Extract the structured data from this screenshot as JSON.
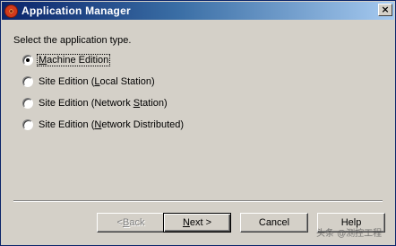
{
  "window": {
    "title": "Application Manager",
    "close_label": "×"
  },
  "prompt": "Select the application type.",
  "options": [
    {
      "pre": "",
      "accel": "M",
      "post": "achine Edition",
      "checked": true
    },
    {
      "pre": "Site Edition (",
      "accel": "L",
      "post": "ocal Station)",
      "checked": false
    },
    {
      "pre": "Site Edition (Network ",
      "accel": "S",
      "post": "tation)",
      "checked": false
    },
    {
      "pre": "Site Edition (",
      "accel": "N",
      "post": "etwork Distributed)",
      "checked": false
    }
  ],
  "buttons": {
    "back": {
      "prefix": "< ",
      "accel": "B",
      "rest": "ack"
    },
    "next": {
      "accel": "N",
      "rest": "ext >"
    },
    "cancel": "Cancel",
    "help": "Help"
  },
  "watermark": "头条 @测控工程"
}
